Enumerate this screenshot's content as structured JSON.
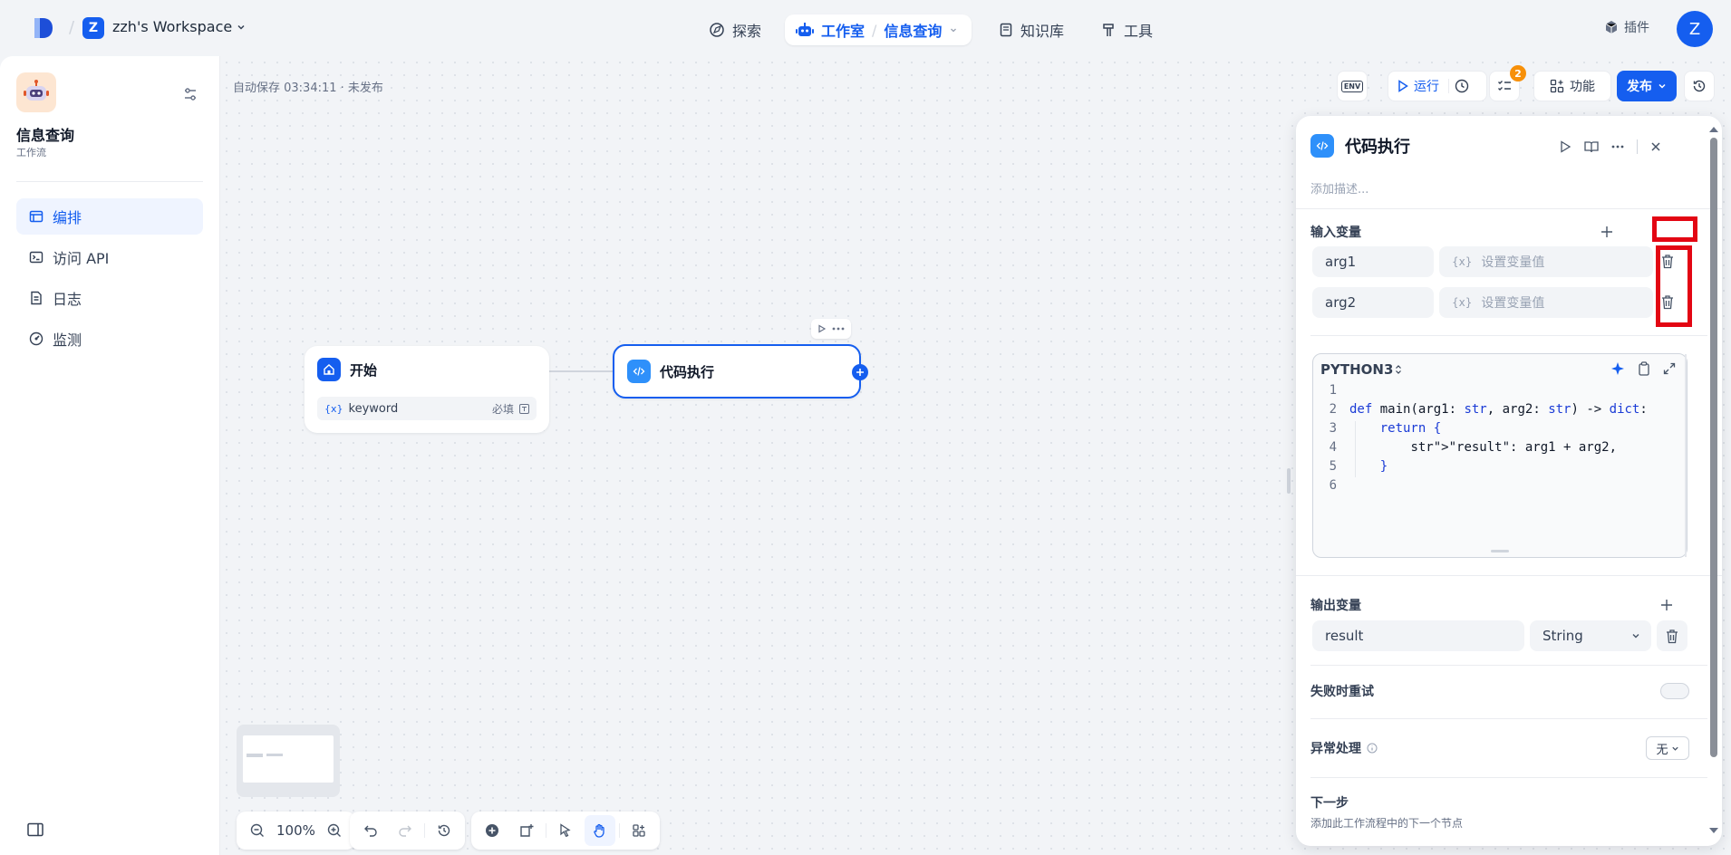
{
  "topbar": {
    "workspace_initial": "Z",
    "workspace_name": "zzh's Workspace",
    "nav_explore": "探索",
    "nav_studio": "工作室",
    "nav_app": "信息查询",
    "nav_knowledge": "知识库",
    "nav_tools": "工具",
    "plugin": "插件",
    "user_initial": "Z"
  },
  "sidebar": {
    "app_name": "信息查询",
    "app_type": "工作流",
    "items": [
      {
        "label": "编排",
        "icon": "orchestrate-icon",
        "active": true
      },
      {
        "label": "访问 API",
        "icon": "terminal-icon",
        "active": false
      },
      {
        "label": "日志",
        "icon": "logs-icon",
        "active": false
      },
      {
        "label": "监测",
        "icon": "monitor-icon",
        "active": false
      }
    ]
  },
  "canvas": {
    "autosave": "自动保存 03:34:11 · 未发布",
    "toolbar": {
      "env": "ENV",
      "run": "运行",
      "checklist_count": "2",
      "features": "功能",
      "publish": "发布"
    },
    "zoom": "100%"
  },
  "nodes": {
    "start": {
      "title": "开始",
      "var_name": "keyword",
      "var_required": "必填"
    },
    "code": {
      "title": "代码执行"
    }
  },
  "panel": {
    "title": "代码执行",
    "description_placeholder": "添加描述...",
    "input_vars_label": "输入变量",
    "input_vars": [
      {
        "name": "arg1",
        "value_placeholder": "设置变量值"
      },
      {
        "name": "arg2",
        "value_placeholder": "设置变量值"
      }
    ],
    "var_prefix": "{x}",
    "language": "PYTHON3",
    "code_lines": [
      "",
      "def main(arg1: str, arg2: str) -> dict:",
      "    return {",
      "        \"result\": arg1 + arg2,",
      "    }",
      ""
    ],
    "output_vars_label": "输出变量",
    "output_var_name": "result",
    "output_var_type": "String",
    "retry_label": "失败时重试",
    "error_label": "异常处理",
    "error_value": "无",
    "next_label": "下一步",
    "next_desc": "添加此工作流程中的下一个节点"
  },
  "colors": {
    "accent": "#155eef",
    "highlight_red": "#e30613",
    "badge_orange": "#f79009"
  }
}
